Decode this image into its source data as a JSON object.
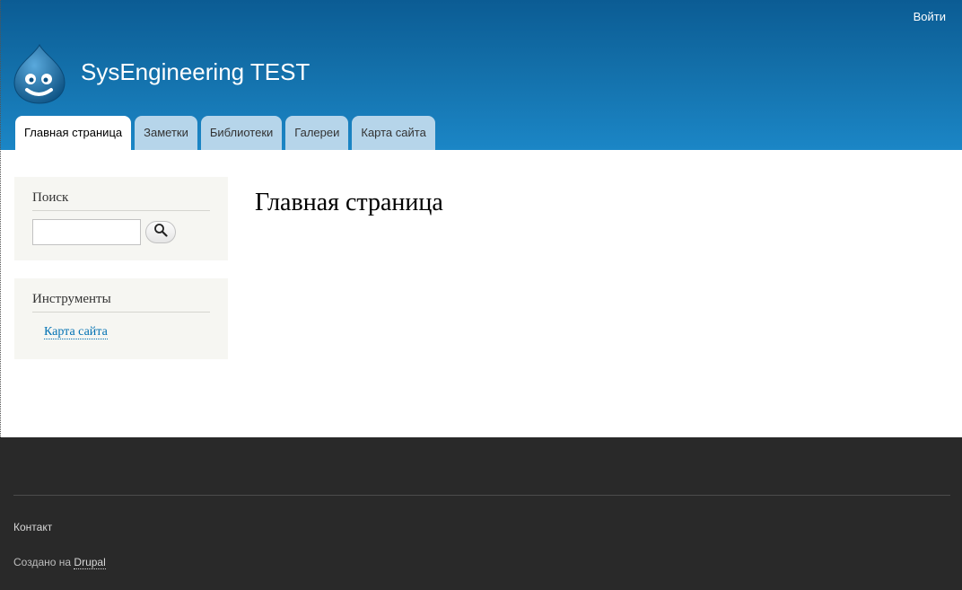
{
  "header": {
    "login_link": "Войти",
    "site_name": "SysEngineering TEST",
    "logo_icon": "drupal-drop-logo",
    "tabs": [
      {
        "label": "Главная страница",
        "active": true
      },
      {
        "label": "Заметки"
      },
      {
        "label": "Библиотеки"
      },
      {
        "label": "Галереи"
      },
      {
        "label": "Карта сайта"
      }
    ]
  },
  "sidebar": {
    "search": {
      "title": "Поиск",
      "input_value": "",
      "button_icon": "search-icon"
    },
    "tools": {
      "title": "Инструменты",
      "links": [
        {
          "label": "Карта сайта"
        }
      ]
    }
  },
  "main": {
    "title": "Главная страница"
  },
  "footer": {
    "contact_link": "Контакт",
    "powered_prefix": "Создано на",
    "powered_link": "Drupal"
  },
  "colors": {
    "header_top": "#0b5c94",
    "header_bottom": "#1b86c6",
    "tab_inactive": "#b6d5ea",
    "sidebar_block": "#f6f6f2",
    "link": "#0071b3",
    "footer_bg": "#292929"
  }
}
